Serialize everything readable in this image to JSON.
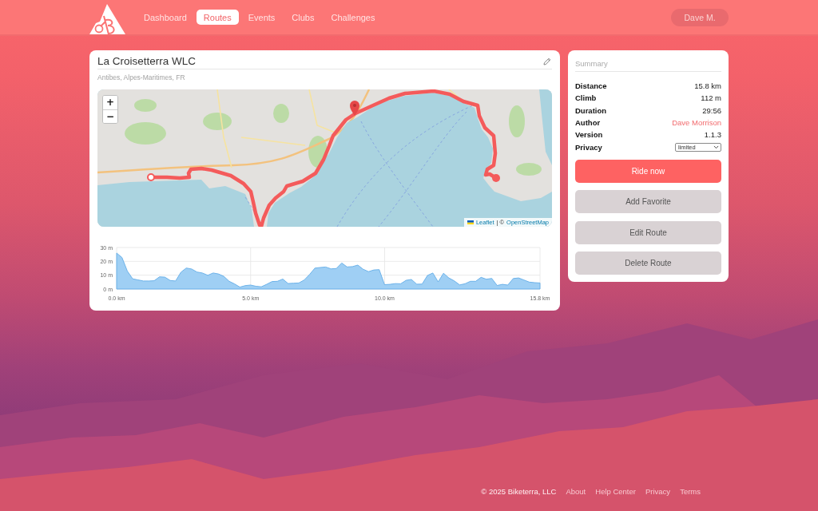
{
  "header": {
    "nav": [
      {
        "label": "Dashboard",
        "selected": false
      },
      {
        "label": "Routes",
        "selected": true
      },
      {
        "label": "Events",
        "selected": false
      },
      {
        "label": "Clubs",
        "selected": false
      },
      {
        "label": "Challenges",
        "selected": false
      }
    ],
    "user": "Dave M."
  },
  "route": {
    "title": "La Croisetterra WLC",
    "location": "Antibes, Alpes-Maritimes, FR",
    "map": {
      "zoom_in": "+",
      "zoom_out": "−",
      "attribution": [
        {
          "kind": "link",
          "text": "Leaflet"
        },
        {
          "kind": "text",
          "text": "| ©"
        },
        {
          "kind": "link",
          "text": "OpenStreetMap"
        }
      ]
    },
    "elevation": {
      "chart_data": {
        "type": "area",
        "grid": true,
        "x": [
          0,
          0.2,
          0.4,
          0.6,
          0.8,
          1,
          1.2,
          1.4,
          1.6,
          1.8,
          2,
          2.2,
          2.4,
          2.6,
          2.8,
          3,
          3.2,
          3.4,
          3.6,
          3.8,
          4,
          4.2,
          4.4,
          4.6,
          4.8,
          5,
          5.2,
          5.4,
          5.6,
          5.8,
          6,
          6.2,
          6.4,
          6.6,
          6.8,
          7,
          7.2,
          7.4,
          7.6,
          7.8,
          8,
          8.2,
          8.4,
          8.6,
          8.8,
          9,
          9.2,
          9.4,
          9.6,
          9.8,
          10,
          10.2,
          10.4,
          10.6,
          10.8,
          11,
          11.2,
          11.4,
          11.6,
          11.8,
          12,
          12.2,
          12.4,
          12.6,
          12.8,
          13,
          13.2,
          13.4,
          13.6,
          13.8,
          14,
          14.2,
          14.4,
          14.6,
          14.8,
          15,
          15.2,
          15.4,
          15.6,
          15.8
        ],
        "values": [
          26,
          22.8,
          13,
          7.4,
          6.6,
          5.8,
          5.8,
          6,
          8.8,
          8.6,
          6.2,
          5.8,
          12.2,
          15.2,
          14.5,
          12.3,
          11.6,
          9.9,
          11.6,
          10.9,
          9.2,
          5.6,
          3.7,
          1.4,
          2.5,
          2.9,
          2,
          1.6,
          3.4,
          5.4,
          5.6,
          7.2,
          4,
          4.2,
          4.4,
          6.5,
          10.5,
          15.1,
          15.6,
          15.9,
          14.6,
          14.8,
          18.8,
          16,
          16.2,
          17.3,
          14.3,
          12.6,
          13.8,
          14,
          3.2,
          3.4,
          3.9,
          3.8,
          6.3,
          6.9,
          3.5,
          3.6,
          9.8,
          11.6,
          5.2,
          11.4,
          8,
          5.9,
          3,
          3.8,
          5.6,
          5.6,
          8.5,
          7.1,
          7.7,
          2.6,
          3.4,
          2.9,
          7.6,
          8,
          6.5,
          5,
          4.6,
          4.4
        ],
        "xlim": [
          0,
          15.8
        ],
        "ylim": [
          0,
          30
        ],
        "xticks": [
          {
            "value": 0,
            "label": "0.0 km"
          },
          {
            "value": 5,
            "label": "5.0 km"
          },
          {
            "value": 10,
            "label": "10.0 km"
          },
          {
            "value": 15.8,
            "label": "15.8 km"
          }
        ],
        "yticks": [
          {
            "value": 0,
            "label": "0 m"
          },
          {
            "value": 10,
            "label": "10 m"
          },
          {
            "value": 20,
            "label": "20 m"
          },
          {
            "value": 30,
            "label": "30 m"
          }
        ]
      }
    }
  },
  "summary": {
    "title": "Summary",
    "rows": [
      {
        "kind": "text",
        "label": "Distance",
        "value": "15.8 km"
      },
      {
        "kind": "text",
        "label": "Climb",
        "value": "112 m"
      },
      {
        "kind": "text",
        "label": "Duration",
        "value": "29:56"
      },
      {
        "kind": "link",
        "label": "Author",
        "value": "Dave Morrison"
      },
      {
        "kind": "text",
        "label": "Version",
        "value": "1.1.3"
      },
      {
        "kind": "select",
        "label": "Privacy",
        "value": "limited"
      }
    ],
    "buttons": [
      {
        "kind": "primary",
        "label": "Ride now"
      },
      {
        "kind": "secondary",
        "label": "Add Favorite"
      },
      {
        "kind": "secondary",
        "label": "Edit Route"
      },
      {
        "kind": "secondary",
        "label": "Delete Route"
      }
    ]
  },
  "footer": {
    "copyright": "© 2025 Biketerra, LLC",
    "links": [
      "About",
      "Help Center",
      "Privacy",
      "Terms"
    ]
  }
}
